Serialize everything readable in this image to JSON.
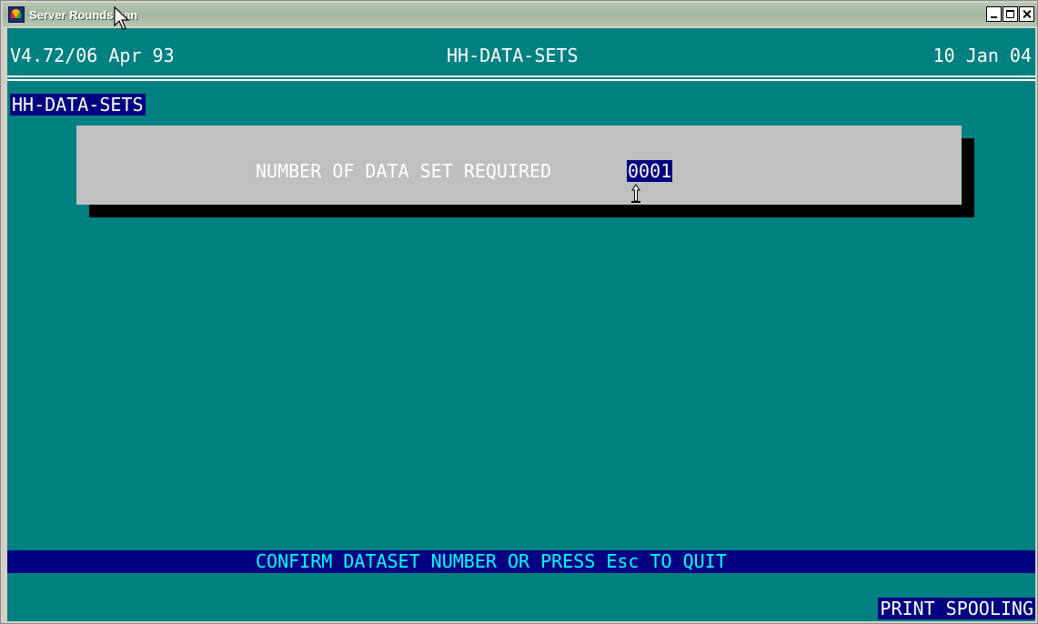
{
  "window": {
    "title": "Server Roundsman",
    "buttons": {
      "minimize": "minimize",
      "maximize": "maximize",
      "close": "close"
    }
  },
  "header": {
    "version": "V4.72/06 Apr 93",
    "screen_name": "HH-DATA-SETS",
    "date": "10 Jan 04"
  },
  "section": {
    "label": "HH-DATA-SETS"
  },
  "dialog": {
    "prompt": "NUMBER OF DATA SET REQUIRED",
    "value": "0001"
  },
  "status": {
    "message": "CONFIRM DATASET NUMBER OR PRESS Esc TO QUIT",
    "spooling": "PRINT SPOOLING"
  },
  "colors": {
    "screen_bg": "#008080",
    "dialog_bg": "#c0c0c0",
    "highlight_bg": "#000080",
    "status_text": "#00ffff"
  },
  "icons": {
    "app": "rainbow-app-icon",
    "cursor": "text-cursor-icon",
    "pointer": "mouse-pointer-icon"
  }
}
